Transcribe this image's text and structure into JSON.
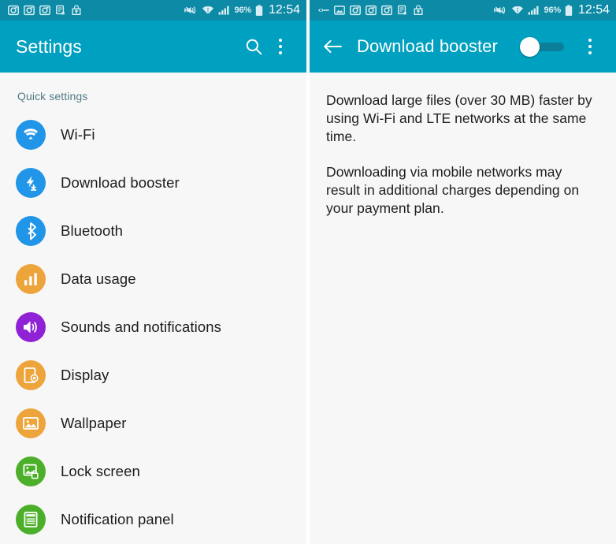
{
  "status_bar": {
    "left_icons_left_panel": [
      "screenshot-icon",
      "screenshot-icon",
      "screenshot-icon",
      "document-error-icon",
      "upload-bag-icon"
    ],
    "left_icons_right_panel": [
      "link-eye-icon",
      "image-icon",
      "screenshot-icon",
      "screenshot-icon",
      "screenshot-icon",
      "document-error-icon",
      "upload-bag-icon"
    ],
    "right_icons": [
      "mute-vibrate-icon",
      "wifi-icon",
      "signal-icon",
      "battery-icon"
    ],
    "battery_percent": "96%",
    "clock": "12:54"
  },
  "left_screen": {
    "appbar": {
      "title": "Settings",
      "search_icon": "search-icon",
      "overflow_icon": "more-vertical-icon"
    },
    "section_header": "Quick settings",
    "items": [
      {
        "label": "Wi-Fi",
        "icon": "wifi-icon",
        "color": "#2196e8"
      },
      {
        "label": "Download booster",
        "icon": "download-booster-icon",
        "color": "#2196e8"
      },
      {
        "label": "Bluetooth",
        "icon": "bluetooth-icon",
        "color": "#2196e8"
      },
      {
        "label": "Data usage",
        "icon": "data-usage-icon",
        "color": "#eda43b"
      },
      {
        "label": "Sounds and notifications",
        "icon": "speaker-icon",
        "color": "#9022d6"
      },
      {
        "label": "Display",
        "icon": "display-icon",
        "color": "#eda43b"
      },
      {
        "label": "Wallpaper",
        "icon": "wallpaper-icon",
        "color": "#eda43b"
      },
      {
        "label": "Lock screen",
        "icon": "lock-screen-icon",
        "color": "#4caf29"
      },
      {
        "label": "Notification panel",
        "icon": "notification-panel-icon",
        "color": "#4caf29"
      }
    ]
  },
  "right_screen": {
    "appbar": {
      "back_icon": "back-arrow-icon",
      "title": "Download booster",
      "toggle_state": "off",
      "overflow_icon": "more-vertical-icon"
    },
    "paragraphs": [
      "Download large files (over 30 MB) faster by using Wi-Fi and LTE networks at the same time.",
      "Downloading via mobile networks may result in additional charges depending on your payment plan."
    ]
  },
  "colors": {
    "statusbar": "#0d8aa5",
    "appbar": "#00a0c0",
    "background": "#f7f7f7",
    "section_header_text": "#4f7c86"
  }
}
